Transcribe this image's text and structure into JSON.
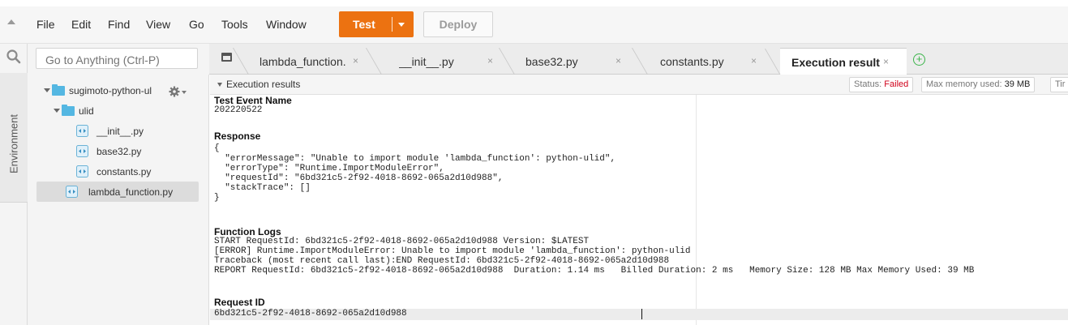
{
  "menu": {
    "items": [
      "File",
      "Edit",
      "Find",
      "View",
      "Go",
      "Tools",
      "Window"
    ],
    "test_label": "Test",
    "deploy_label": "Deploy",
    "accent": "#ec7211"
  },
  "left_rail": {
    "environment_label": "Environment"
  },
  "goto": {
    "placeholder": "Go to Anything (Ctrl-P)"
  },
  "tabs": [
    {
      "label": "lambda_function.",
      "close": "×"
    },
    {
      "label": "__init__.py",
      "close": "×"
    },
    {
      "label": "base32.py",
      "close": "×"
    },
    {
      "label": "constants.py",
      "close": "×"
    },
    {
      "label": "Execution result:",
      "close": "×",
      "active": true
    }
  ],
  "tree": {
    "root": "sugimoto-python-ul",
    "folder": "ulid",
    "files": [
      "__init__.py",
      "base32.py",
      "constants.py"
    ],
    "root_file": "lambda_function.py"
  },
  "results": {
    "header_title": "Execution results",
    "status_label": "Status: ",
    "status_value": "Failed",
    "status_color": "#d0021b",
    "memory_label": "Max memory used: ",
    "memory_value": "39 MB",
    "time_label": "Tir",
    "test_event_title": "Test Event Name",
    "test_event_value": "202220522",
    "response_title": "Response",
    "response_lines": [
      "{",
      "  \"errorMessage\": \"Unable to import module 'lambda_function': python-ulid\",",
      "  \"errorType\": \"Runtime.ImportModuleError\",",
      "  \"requestId\": \"6bd321c5-2f92-4018-8692-065a2d10d988\",",
      "  \"stackTrace\": []",
      "}"
    ],
    "logs_title": "Function Logs",
    "log_lines": [
      "START RequestId: 6bd321c5-2f92-4018-8692-065a2d10d988 Version: $LATEST",
      "[ERROR] Runtime.ImportModuleError: Unable to import module 'lambda_function': python-ulid",
      "Traceback (most recent call last):END RequestId: 6bd321c5-2f92-4018-8692-065a2d10d988",
      "REPORT RequestId: 6bd321c5-2f92-4018-8692-065a2d10d988  Duration: 1.14 ms   Billed Duration: 2 ms   Memory Size: 128 MB Max Memory Used: 39 MB"
    ],
    "request_id_title": "Request ID",
    "request_id_value": "6bd321c5-2f92-4018-8692-065a2d10d988"
  }
}
